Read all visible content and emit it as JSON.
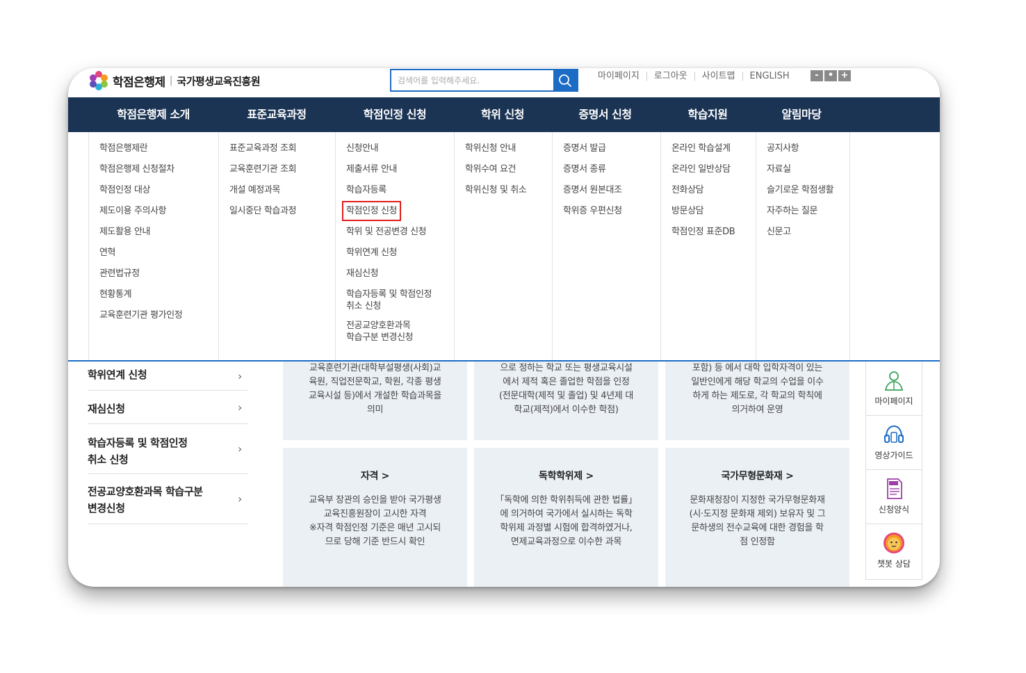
{
  "header": {
    "logo_main": "학점은행제",
    "logo_sub": "국가평생교육진흥원",
    "search_placeholder": "검색어를 입력해주세요.",
    "util_links": [
      "마이페이지",
      "로그아웃",
      "사이트맵",
      "ENGLISH"
    ],
    "zoom_buttons": [
      "-",
      "•",
      "+"
    ]
  },
  "gnb": [
    "학점은행제 소개",
    "표준교육과정",
    "학점인정 신청",
    "학위 신청",
    "증명서 신청",
    "학습지원",
    "알림마당"
  ],
  "mega": [
    [
      "학점은행제란",
      "학점은행제 신청절차",
      "학점인정 대상",
      "제도이용 주의사항",
      "제도활용 안내",
      "연혁",
      "관련법규정",
      "현황통계",
      "교육훈련기관 평가인정"
    ],
    [
      "표준교육과정 조회",
      "교육훈련기관 조회",
      "개설 예정과목",
      "일시중단 학습과정"
    ],
    [
      "신청안내",
      "제출서류 안내",
      "학습자등록",
      "학점인정 신청",
      "학위 및 전공변경 신청",
      "학위연계 신청",
      "재심신청",
      "학습자등록 및 학점인정",
      "취소 신청",
      "전공교양호환과목",
      "학습구분 변경신청"
    ],
    [
      "학위신청 안내",
      "학위수여 요건",
      "학위신청 및 취소"
    ],
    [
      "증명서 발급",
      "증명서 종류",
      "증명서 원본대조",
      "학위증 우편신청"
    ],
    [
      "온라인 학습설계",
      "온라인 일반상담",
      "전화상담",
      "방문상담",
      "학점인정 표준DB"
    ],
    [
      "공지사항",
      "자료실",
      "슬기로운 학점생활",
      "자주하는 질문",
      "신문고"
    ]
  ],
  "lnb": [
    {
      "label": "학위연계 신청",
      "line2": ""
    },
    {
      "label": "재심신청",
      "line2": ""
    },
    {
      "label": "학습자등록 및 학점인정",
      "line2": "취소 신청"
    },
    {
      "label": "전공교양호환과목 학습구분",
      "line2": "변경신청"
    }
  ],
  "cards_top": [
    [
      "교육훈련기관(대학부설평생(사회)교",
      "육원, 직업전문학교, 학원, 각종 평생",
      "교육시설 등)에서 개설한 학습과목을",
      "의미"
    ],
    [
      "으로 정하는 학교 또는 평생교육시설",
      "에서 제적 혹은 졸업한 학점을 인정",
      "(전문대학(제적 및 졸업) 및 4년제 대",
      "학교(제적)에서 이수한 학점)"
    ],
    [
      "포함) 등 에서 대학 입학자격이 있는",
      "일반인에게 해당 학교의 수업을 이수",
      "하게 하는 제도로, 각 학교의 학칙에",
      "의거하여 운영"
    ]
  ],
  "cards_bottom": [
    {
      "title": "자격 >",
      "lines": [
        "교육부 장관의 승인을 받아 국가평생",
        "교육진흥원장이 고시한 자격",
        "※자격 학점인정 기준은 매년 고시되",
        "므로 당해 기준 반드시 확인"
      ]
    },
    {
      "title": "독학학위제 >",
      "lines": [
        "「독학에 의한 학위취득에 관한 법률」",
        "에 의거하여 국가에서 실시하는 독학",
        "학위제 과정별 시험에 합격하였거나,",
        "면제교육과정으로 이수한 과목"
      ]
    },
    {
      "title": "국가무형문화재 >",
      "lines": [
        "문화재청장이 지정한 국가무형문화재",
        "(시·도지정 문화재 제외) 보유자 및 그",
        "문하생의 전수교육에 대한 경험을 학",
        "점 인정함"
      ]
    }
  ],
  "quick": [
    "마이페이지",
    "영상가이드",
    "신청양식",
    "챗봇 상담"
  ],
  "colors": {
    "navy": "#1b3454",
    "blue": "#1c6cc5",
    "card": "#ebf0f5",
    "highlight": "#e21b1b"
  }
}
